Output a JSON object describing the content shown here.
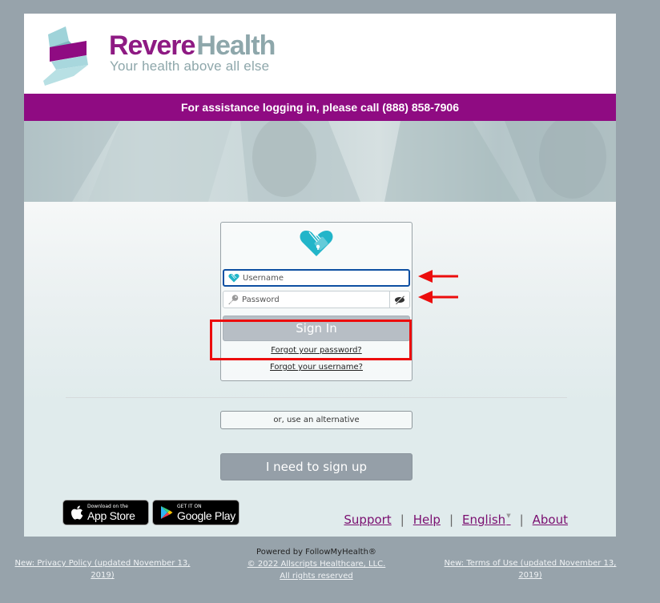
{
  "brand": {
    "name_part1": "Revere",
    "name_part2": "Health",
    "tagline": "Your health above all else",
    "colors": {
      "purple": "#8f0b82",
      "teal_gray": "#8ea7ab",
      "logo_teal": "#8ccdd4"
    }
  },
  "assist_bar": {
    "text": "For assistance logging in, please call (888) 858-7906"
  },
  "login": {
    "logo_icon": "heart-lock-icon",
    "username": {
      "placeholder": "Username",
      "value": "",
      "icon": "heart-shield-icon"
    },
    "password": {
      "placeholder": "Password",
      "value": "",
      "icon": "key-icon",
      "toggle_icon": "eye-slash-icon"
    },
    "sign_in_label": "Sign In",
    "forgot_password": "Forgot your password?",
    "forgot_username": "Forgot your username?",
    "annotation_color": "#ec0d0d"
  },
  "alternative_label": "or, use an alternative",
  "signup_label": "I need to sign up",
  "stores": {
    "apple": {
      "small": "Download on the",
      "big": "App Store",
      "icon": "apple-icon"
    },
    "google": {
      "small": "GET IT ON",
      "big": "Google Play",
      "icon": "google-play-icon"
    }
  },
  "footer_links": {
    "support": "Support",
    "help": "Help",
    "language": "English",
    "about": "About",
    "separator": "|"
  },
  "page_footer": {
    "privacy": "New: Privacy Policy (updated November 13, 2019)",
    "powered_by": "Powered by FollowMyHealth®",
    "copyright": "© 2022 Allscripts Healthcare, LLC.",
    "rights": "All rights reserved",
    "terms": "New: Terms of Use (updated November 13, 2019)"
  }
}
